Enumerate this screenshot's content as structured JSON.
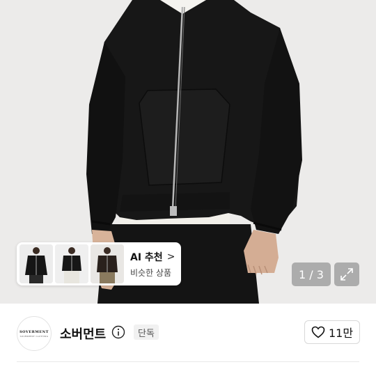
{
  "ai_recommend": {
    "title": "AI 추천",
    "chevron": ">",
    "subtitle": "비슷한 상품",
    "thumbnails": [
      "black-zip-hoodie-thumb",
      "black-zip-hoodie-thumb-2",
      "brown-zip-hoodie-thumb"
    ]
  },
  "gallery": {
    "counter": "1 / 3",
    "expand_icon": "expand-icon"
  },
  "brand": {
    "logo_text": "SOVERMENT",
    "logo_subtext": "SOVERMENT CLOTHING",
    "name": "소버먼트",
    "badge": "단독"
  },
  "like": {
    "count": "11만",
    "icon": "heart-icon"
  },
  "colors": {
    "hoodie": "#161616",
    "background": "#ecebea",
    "shirt": "#f2f0ea",
    "overlay": "#787878"
  }
}
